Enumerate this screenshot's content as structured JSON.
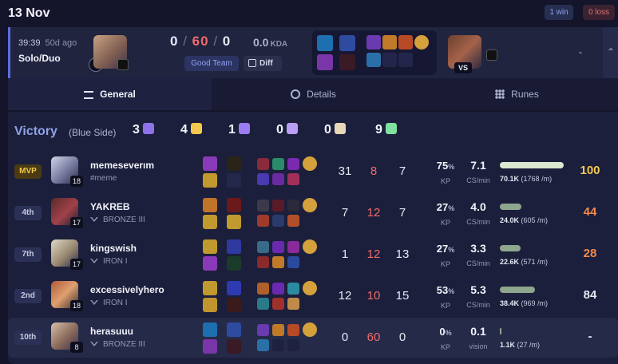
{
  "header": {
    "date": "13 Nov",
    "wins": "1 win",
    "losses": "0 loss"
  },
  "match": {
    "duration": "39:39",
    "ago": "50d ago",
    "queue": "Solo/Duo",
    "kills": "0",
    "deaths": "60",
    "assists": "0",
    "kda_ratio": "0.0",
    "kda_label": "KDA",
    "team_tag": "Good Team",
    "diff_label": "Diff",
    "vs_label": "VS",
    "result_dash": "-",
    "expand_icon": "chevron-up-icon"
  },
  "tabs": [
    {
      "label": "General",
      "icon": "list-icon"
    },
    {
      "label": "Details",
      "icon": "pie-chart-icon"
    },
    {
      "label": "Runes",
      "icon": "grid-icon"
    }
  ],
  "team": {
    "result": "Victory",
    "side": "(Blue Side)",
    "objectives": [
      {
        "value": "3",
        "icon": "baron-icon",
        "color": "#8e73e8"
      },
      {
        "value": "4",
        "icon": "dragon-icon",
        "color": "#f2c94c"
      },
      {
        "value": "1",
        "icon": "herald-icon",
        "color": "#9a7cf0"
      },
      {
        "value": "0",
        "icon": "grubs-icon",
        "color": "#b99ef5"
      },
      {
        "value": "0",
        "icon": "tower-icon",
        "color": "#e8d7b8"
      },
      {
        "value": "9",
        "icon": "turret-icon",
        "color": "#7fe0a0"
      }
    ]
  },
  "players": [
    {
      "rank": "MVP",
      "name": "memeseverım",
      "sub": "#meme",
      "level": "18",
      "kills": "31",
      "deaths": "8",
      "assists": "7",
      "kp": "75",
      "kp_unit": "%",
      "kp_label": "KP",
      "cs": "7.1",
      "cs_label": "CS/min",
      "damage": "70.1K",
      "dmg_per_min": "(1768 /m)",
      "dmg_fraction": 1.0,
      "score": "100",
      "score_color": "#f2c94c",
      "bar_color": "#dbe9d0"
    },
    {
      "rank": "4th",
      "name": "YAKREB",
      "sub": "BRONZE III",
      "level": "17",
      "kills": "7",
      "deaths": "12",
      "assists": "7",
      "kp": "27",
      "kp_unit": "%",
      "kp_label": "KP",
      "cs": "4.0",
      "cs_label": "CS/min",
      "damage": "24.0K",
      "dmg_per_min": "(605 /m)",
      "dmg_fraction": 0.34,
      "score": "44",
      "score_color": "#f28a4c",
      "bar_color": "#8ea68e"
    },
    {
      "rank": "7th",
      "name": "kingswish",
      "sub": "IRON I",
      "level": "17",
      "kills": "1",
      "deaths": "12",
      "assists": "13",
      "kp": "27",
      "kp_unit": "%",
      "kp_label": "KP",
      "cs": "3.3",
      "cs_label": "CS/min",
      "damage": "22.6K",
      "dmg_per_min": "(571 /m)",
      "dmg_fraction": 0.32,
      "score": "28",
      "score_color": "#f28a4c",
      "bar_color": "#8ea68e"
    },
    {
      "rank": "2nd",
      "name": "excessivelyhero",
      "sub": "IRON I",
      "level": "18",
      "kills": "12",
      "deaths": "10",
      "assists": "15",
      "kp": "53",
      "kp_unit": "%",
      "kp_label": "KP",
      "cs": "5.3",
      "cs_label": "CS/min",
      "damage": "38.4K",
      "dmg_per_min": "(969 /m)",
      "dmg_fraction": 0.55,
      "score": "84",
      "score_color": "#e6e8f5",
      "bar_color": "#8ea68e"
    },
    {
      "rank": "10th",
      "name": "herasuuu",
      "sub": "BRONZE III",
      "level": "8",
      "kills": "0",
      "deaths": "60",
      "assists": "0",
      "kp": "0",
      "kp_unit": "%",
      "kp_label": "KP",
      "cs": "0.1",
      "cs_label": "vision",
      "damage": "1.1K",
      "dmg_per_min": "(27 /m)",
      "dmg_fraction": 0.0,
      "score": "-",
      "score_color": "#e6e8f5",
      "bar_color": "#8ea68e"
    }
  ]
}
